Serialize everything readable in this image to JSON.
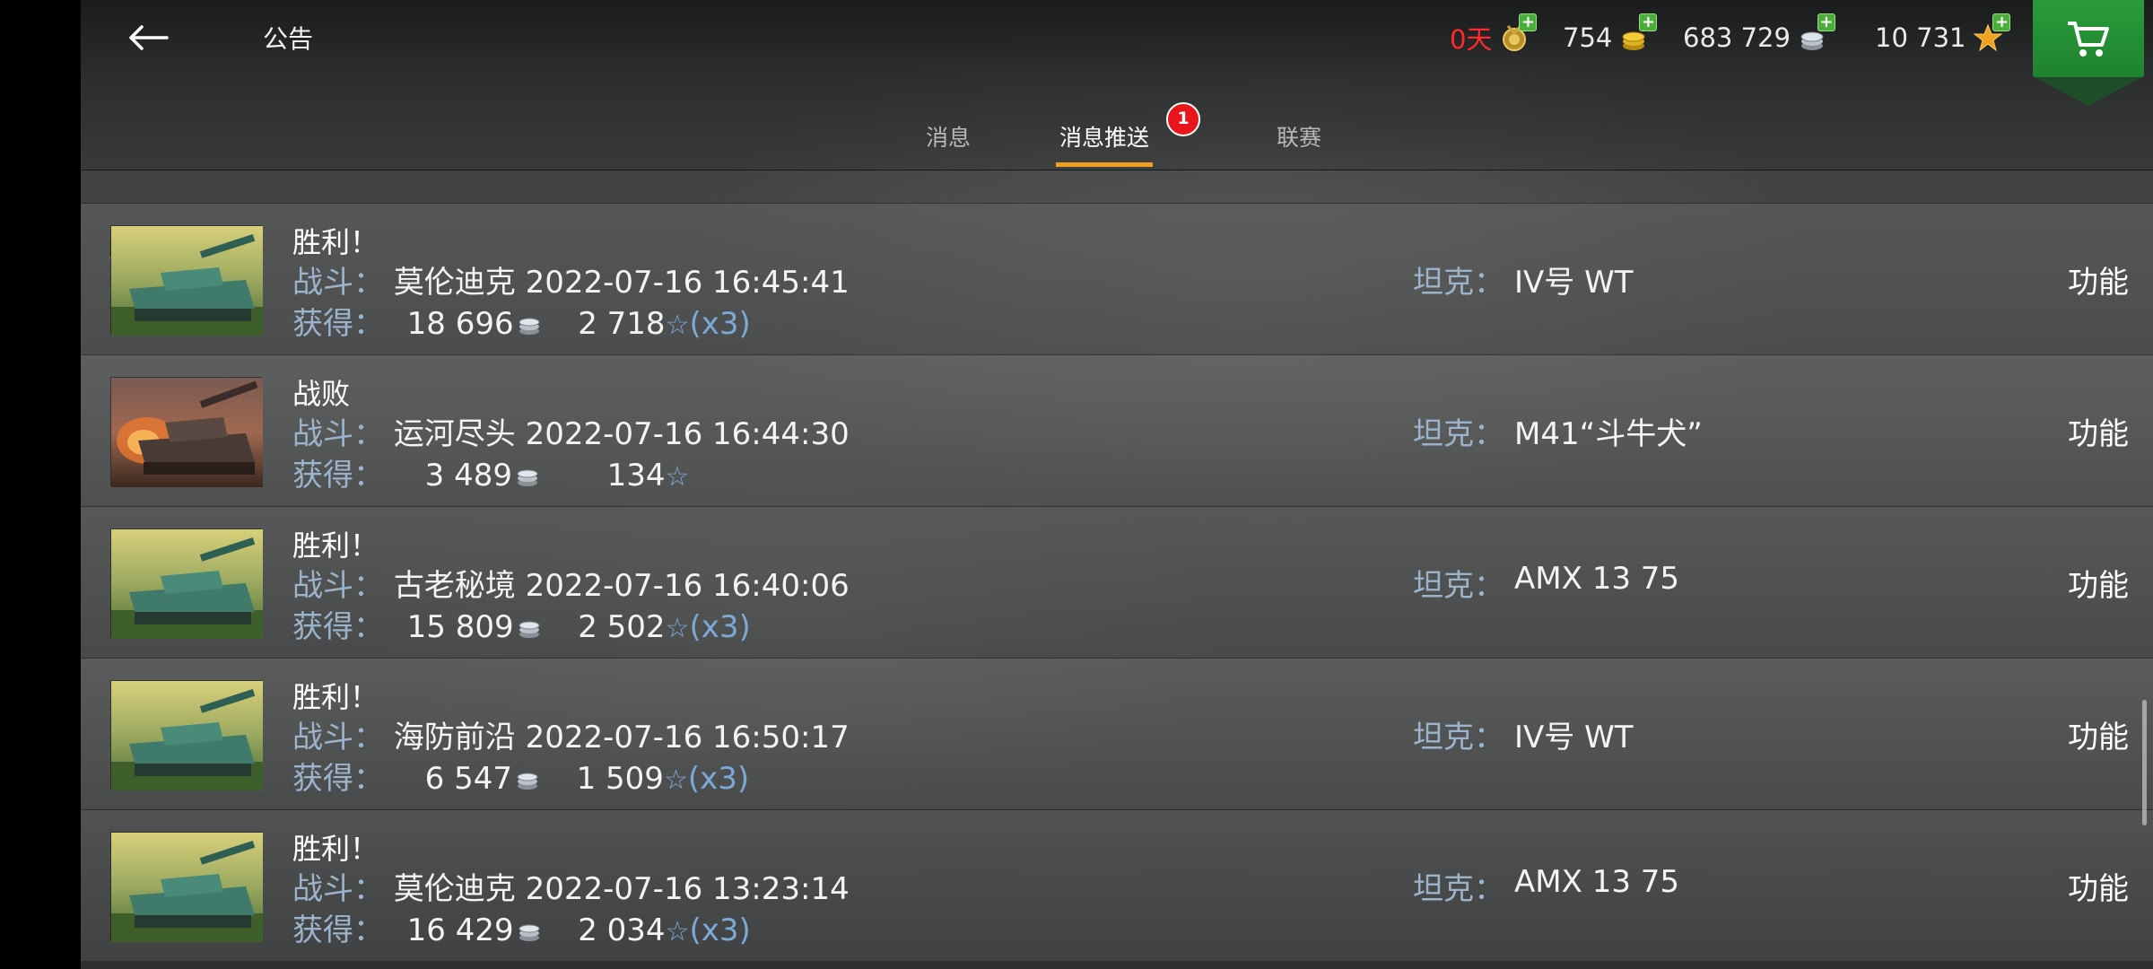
{
  "header": {
    "title": "公告",
    "back_icon": "back-arrow-icon",
    "days": "0天",
    "gold": "754",
    "silver": "683 729",
    "xp": "10 731",
    "days_color": "#ff2a2a"
  },
  "tabs": [
    {
      "label": "消息",
      "active": false
    },
    {
      "label": "消息推送",
      "active": true,
      "badge": "1"
    },
    {
      "label": "联赛",
      "active": false
    }
  ],
  "labels": {
    "battle": "战斗：",
    "earned": "获得：",
    "tank": "坦克：",
    "function": "功能"
  },
  "rows": [
    {
      "result": "胜利！",
      "map": "莫伦迪克",
      "time": "2022-07-16 16:45:41",
      "silver": "18 696",
      "xp": "2 718",
      "mult": "(x3)",
      "tank": "IV号 WT",
      "thumb": "victory"
    },
    {
      "result": "战败",
      "map": "运河尽头",
      "time": "2022-07-16 16:44:30",
      "silver": "3 489",
      "xp": "134",
      "mult": "",
      "tank": "M41“斗牛犬”",
      "thumb": "defeat"
    },
    {
      "result": "胜利！",
      "map": "古老秘境",
      "time": "2022-07-16 16:40:06",
      "silver": "15 809",
      "xp": "2 502",
      "mult": "(x3)",
      "tank": "AMX 13 75",
      "thumb": "victory"
    },
    {
      "result": "胜利！",
      "map": "海防前沿",
      "time": "2022-07-16 16:50:17",
      "silver": "6 547",
      "xp": "1 509",
      "mult": "(x3)",
      "tank": "IV号 WT",
      "thumb": "victory"
    },
    {
      "result": "胜利！",
      "map": "莫伦迪克",
      "time": "2022-07-16 13:23:14",
      "silver": "16 429",
      "xp": "2 034",
      "mult": "(x3)",
      "tank": "AMX 13 75",
      "thumb": "victory"
    }
  ]
}
